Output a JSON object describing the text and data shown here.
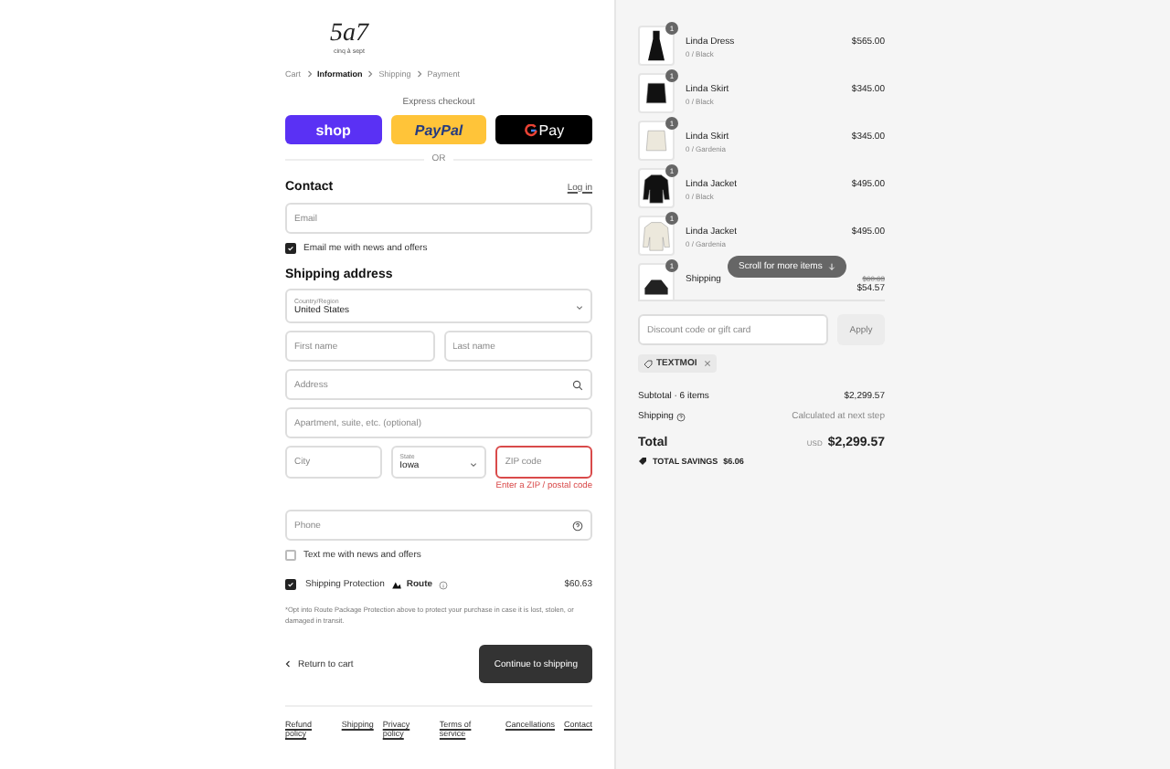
{
  "logo": {
    "mark": "5a7",
    "wordmark": "cinq à sept"
  },
  "breadcrumbs": [
    {
      "label": "Cart",
      "selected": false
    },
    {
      "label": "Information",
      "selected": true
    },
    {
      "label": "Shipping",
      "selected": false
    },
    {
      "label": "Payment",
      "selected": false
    }
  ],
  "express_checkout": {
    "title": "Express checkout",
    "buttons": [
      {
        "kind": "shop",
        "label": "shop"
      },
      {
        "kind": "paypal",
        "label": "PayPal"
      },
      {
        "kind": "gpay",
        "label": "Pay"
      }
    ],
    "divider": "OR"
  },
  "contact": {
    "title": "Contact",
    "login": "Log in",
    "email": {
      "placeholder": "Email"
    },
    "newsletter": {
      "label": "Email me with news and offers",
      "checked": true
    }
  },
  "shipping_address": {
    "title": "Shipping address",
    "country": {
      "label": "Country/Region",
      "value": "United States"
    },
    "first_name": {
      "placeholder": "First name"
    },
    "last_name": {
      "placeholder": "Last name"
    },
    "address": {
      "placeholder": "Address"
    },
    "apartment": {
      "placeholder": "Apartment, suite, etc. (optional)"
    },
    "city": {
      "placeholder": "City"
    },
    "state": {
      "label": "State",
      "value": "Iowa"
    },
    "zip": {
      "placeholder": "ZIP code",
      "error": "Enter a ZIP / postal code"
    },
    "phone": {
      "placeholder": "Phone"
    },
    "sms": {
      "label": "Text me with news and offers",
      "checked": false
    }
  },
  "protection": {
    "label": "Shipping Protection",
    "brand": "Route",
    "price": "$60.63",
    "checked": true,
    "note": "*Opt into Route Package Protection above to protect your purchase in case it is lost, stolen, or damaged in transit."
  },
  "actions": {
    "back": "Return to cart",
    "continue": "Continue to shipping"
  },
  "footer_links": [
    "Refund policy",
    "Shipping",
    "Privacy policy",
    "Terms of service",
    "Cancellations",
    "Contact"
  ],
  "order": {
    "items": [
      {
        "kind": "dress",
        "color": "#111111",
        "name": "Linda Dress",
        "variant": "0 / Black",
        "quantity": "1",
        "price": "$565.00"
      },
      {
        "kind": "skirt",
        "color": "#111111",
        "name": "Linda Skirt",
        "variant": "0 / Black",
        "quantity": "1",
        "price": "$345.00"
      },
      {
        "kind": "skirt",
        "color": "#ece8dc",
        "name": "Linda Skirt",
        "variant": "0 / Gardenia",
        "quantity": "1",
        "price": "$345.00"
      },
      {
        "kind": "jacket",
        "color": "#111111",
        "name": "Linda Jacket",
        "variant": "0 / Black",
        "quantity": "1",
        "price": "$495.00"
      },
      {
        "kind": "jacket",
        "color": "#ece8dc",
        "name": "Linda Jacket",
        "variant": "0 / Gardenia",
        "quantity": "1",
        "price": "$495.00"
      },
      {
        "kind": "route",
        "color": "#222222",
        "name": "Shipping",
        "quantity": "1",
        "old_price": "$60.63",
        "price": "$54.57"
      }
    ],
    "scroll_hint": "Scroll for more items",
    "discount": {
      "placeholder": "Discount code or gift card",
      "button": "Apply"
    },
    "code": "TEXTMOI",
    "subtotal_label": "Subtotal · 6 items",
    "subtotal": "$2,299.57",
    "shipping_label": "Shipping",
    "shipping_value": "Calculated at next step",
    "total_label": "Total",
    "currency": "USD",
    "total": "$2,299.57",
    "savings_label": "TOTAL SAVINGS",
    "savings": "$6.06"
  }
}
